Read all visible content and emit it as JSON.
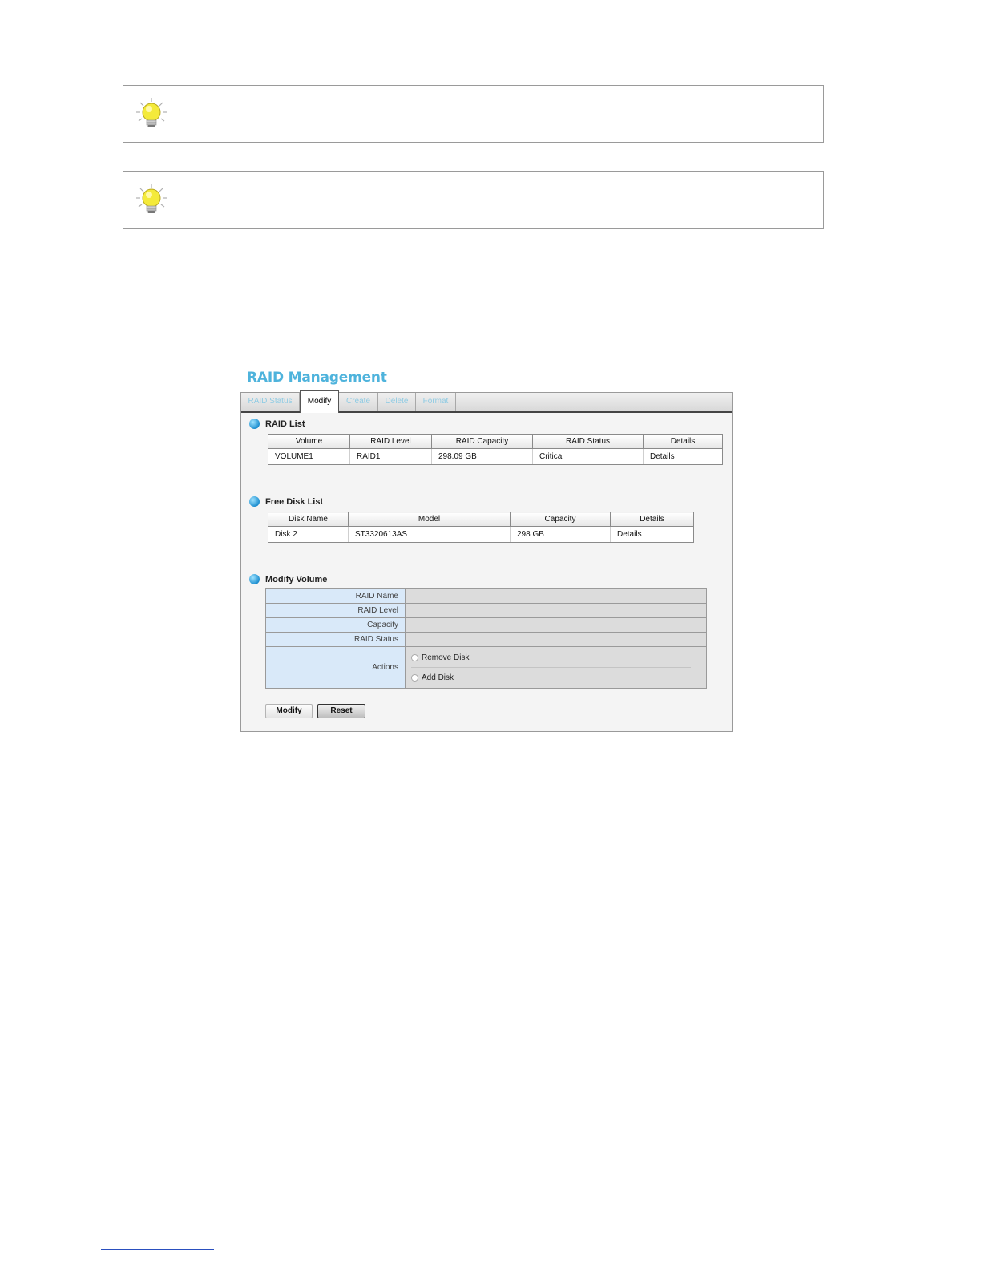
{
  "tips": [
    {
      "icon": "lightbulb-icon",
      "text": ""
    },
    {
      "icon": "lightbulb-icon",
      "text": ""
    }
  ],
  "app": {
    "title": "RAID Management",
    "tabs": [
      {
        "label": "RAID Status",
        "active": false
      },
      {
        "label": "Modify",
        "active": true
      },
      {
        "label": "Create",
        "active": false
      },
      {
        "label": "Delete",
        "active": false
      },
      {
        "label": "Format",
        "active": false
      }
    ]
  },
  "raid_list": {
    "heading": "RAID List",
    "columns": [
      "Volume",
      "RAID Level",
      "RAID Capacity",
      "RAID Status",
      "Details"
    ],
    "rows": [
      [
        "VOLUME1",
        "RAID1",
        "298.09 GB",
        "Critical",
        "Details"
      ]
    ]
  },
  "free_disk_list": {
    "heading": "Free Disk List",
    "columns": [
      "Disk Name",
      "Model",
      "Capacity",
      "Details"
    ],
    "rows": [
      [
        "Disk 2",
        "ST3320613AS",
        "298  GB",
        "Details"
      ]
    ]
  },
  "modify_volume": {
    "heading": "Modify Volume",
    "fields": {
      "raid_name": {
        "label": "RAID Name",
        "value": ""
      },
      "raid_level": {
        "label": "RAID Level",
        "value": ""
      },
      "capacity": {
        "label": "Capacity",
        "value": ""
      },
      "raid_status": {
        "label": "RAID Status",
        "value": ""
      }
    },
    "actions": {
      "label": "Actions",
      "remove_disk": "Remove Disk",
      "add_disk": "Add Disk"
    }
  },
  "buttons": {
    "modify": "Modify",
    "reset": "Reset"
  },
  "colors": {
    "title": "#4eb3dc",
    "tab_inactive": "#8fcbe3",
    "form_label_bg": "#d9e9f9",
    "form_value_bg": "#dcdcdc"
  }
}
